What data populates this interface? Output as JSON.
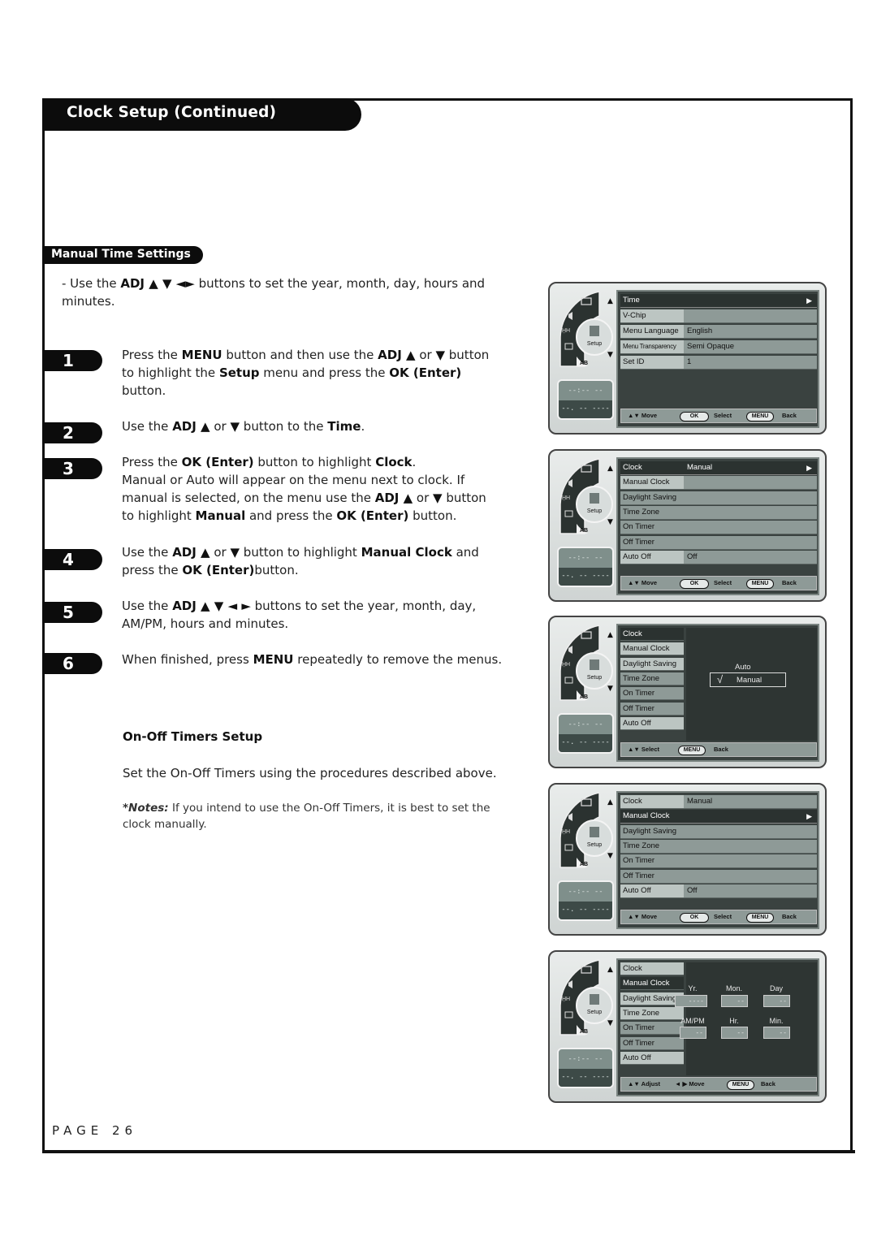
{
  "header": {
    "title": "Clock Setup (Continued)"
  },
  "section": {
    "title": "Manual Time Settings"
  },
  "intro": {
    "prefix": "- Use the ",
    "bold1": "ADJ ▲ ▼ ◄►",
    "rest": " buttons to set the year, month, day, hours and minutes."
  },
  "steps": [
    {
      "num": "1",
      "html": "Press the <b>MENU</b> button and then use the <b>ADJ ▲</b> or <b>▼</b> button to highlight the <b>Setup</b> menu and press the <b>OK (Enter)</b> button."
    },
    {
      "num": "2",
      "html": "Use the <b>ADJ ▲</b> or <b>▼</b> button to the <b>Time</b>."
    },
    {
      "num": "3",
      "html": "Press the <b>OK (Enter)</b> button to highlight <b>Clock</b>.<br>Manual or Auto will appear on the menu next to clock. If manual is selected, on the menu use the <b>ADJ ▲</b> or <b>▼</b> button to highlight <b>Manual</b> and press the <b>OK (Enter)</b> button."
    },
    {
      "num": "4",
      "html": "Use the <b>ADJ ▲</b> or <b>▼</b> button to highlight <b>Manual Clock</b> and press the <b>OK (Enter)</b>button."
    },
    {
      "num": "5",
      "html": "Use the <b>ADJ ▲ ▼ ◄ ►</b> buttons to set the year, month, day, AM/PM, hours and minutes."
    },
    {
      "num": "6",
      "html": "When finished, press <b>MENU</b> repeatedly to remove the menus."
    }
  ],
  "timers": {
    "heading": "On-Off Timers Setup",
    "text": "Set the On-Off Timers using the procedures described above.",
    "note_label": "*Notes:",
    "note_text": " If you intend to use the On-Off Timers, it is best to set the clock manually."
  },
  "footer": {
    "page": "PAGE 26"
  },
  "tv_common": {
    "wheel_center": "Setup",
    "wheel_ab": "AB",
    "display_time": "--:-- --",
    "display_date": "--. -- ----",
    "up_arrow": "▲",
    "down_arrow": "▼",
    "right_arrow": "▶",
    "footer_move": "▲▼ Move",
    "footer_select_key": "OK",
    "footer_select": "Select",
    "footer_menu_key": "MENU",
    "footer_back": "Back",
    "footer_updown_select": "▲▼ Select",
    "footer_adjust": "▲▼ Adjust",
    "footer_lr_move": "◄ ▶ Move"
  },
  "screens": [
    {
      "rows": [
        {
          "label": "Time",
          "value": ""
        },
        {
          "label": "V-Chip",
          "value": ""
        },
        {
          "label": "Menu Language",
          "value": "English"
        },
        {
          "label": "Menu Transparency",
          "value": "Semi Opaque"
        },
        {
          "label": "Set ID",
          "value": "1"
        }
      ]
    },
    {
      "rows": [
        {
          "label": "Clock",
          "value": "Manual"
        },
        {
          "label": "Manual Clock",
          "value": ""
        },
        {
          "label": "Daylight Saving",
          "value": ""
        },
        {
          "label": "Time Zone",
          "value": ""
        },
        {
          "label": "On Timer",
          "value": ""
        },
        {
          "label": "Off Timer",
          "value": ""
        },
        {
          "label": "Auto Off",
          "value": "Off"
        }
      ]
    },
    {
      "rows": [
        {
          "label": "Clock"
        },
        {
          "label": "Manual Clock"
        },
        {
          "label": "Daylight Saving"
        },
        {
          "label": "Time Zone"
        },
        {
          "label": "On Timer"
        },
        {
          "label": "Off Timer"
        },
        {
          "label": "Auto Off"
        }
      ],
      "options": [
        "Auto",
        "Manual"
      ],
      "selected_option": "Manual",
      "check": "√"
    },
    {
      "rows": [
        {
          "label": "Clock",
          "value": "Manual"
        },
        {
          "label": "Manual Clock",
          "value": ""
        },
        {
          "label": "Daylight Saving",
          "value": ""
        },
        {
          "label": "Time Zone",
          "value": ""
        },
        {
          "label": "On Timer",
          "value": ""
        },
        {
          "label": "Off Timer",
          "value": ""
        },
        {
          "label": "Auto Off",
          "value": "Off"
        }
      ]
    },
    {
      "rows": [
        {
          "label": "Clock"
        },
        {
          "label": "Manual Clock"
        },
        {
          "label": "Daylight Saving"
        },
        {
          "label": "Time Zone"
        },
        {
          "label": "On Timer"
        },
        {
          "label": "Off Timer"
        },
        {
          "label": "Auto Off"
        }
      ],
      "fields": [
        {
          "label": "Yr.",
          "value": "----"
        },
        {
          "label": "Mon.",
          "value": "--"
        },
        {
          "label": "Day",
          "value": "--"
        },
        {
          "label": "AM/PM",
          "value": "--"
        },
        {
          "label": "Hr.",
          "value": "--"
        },
        {
          "label": "Min.",
          "value": "--"
        }
      ]
    }
  ]
}
